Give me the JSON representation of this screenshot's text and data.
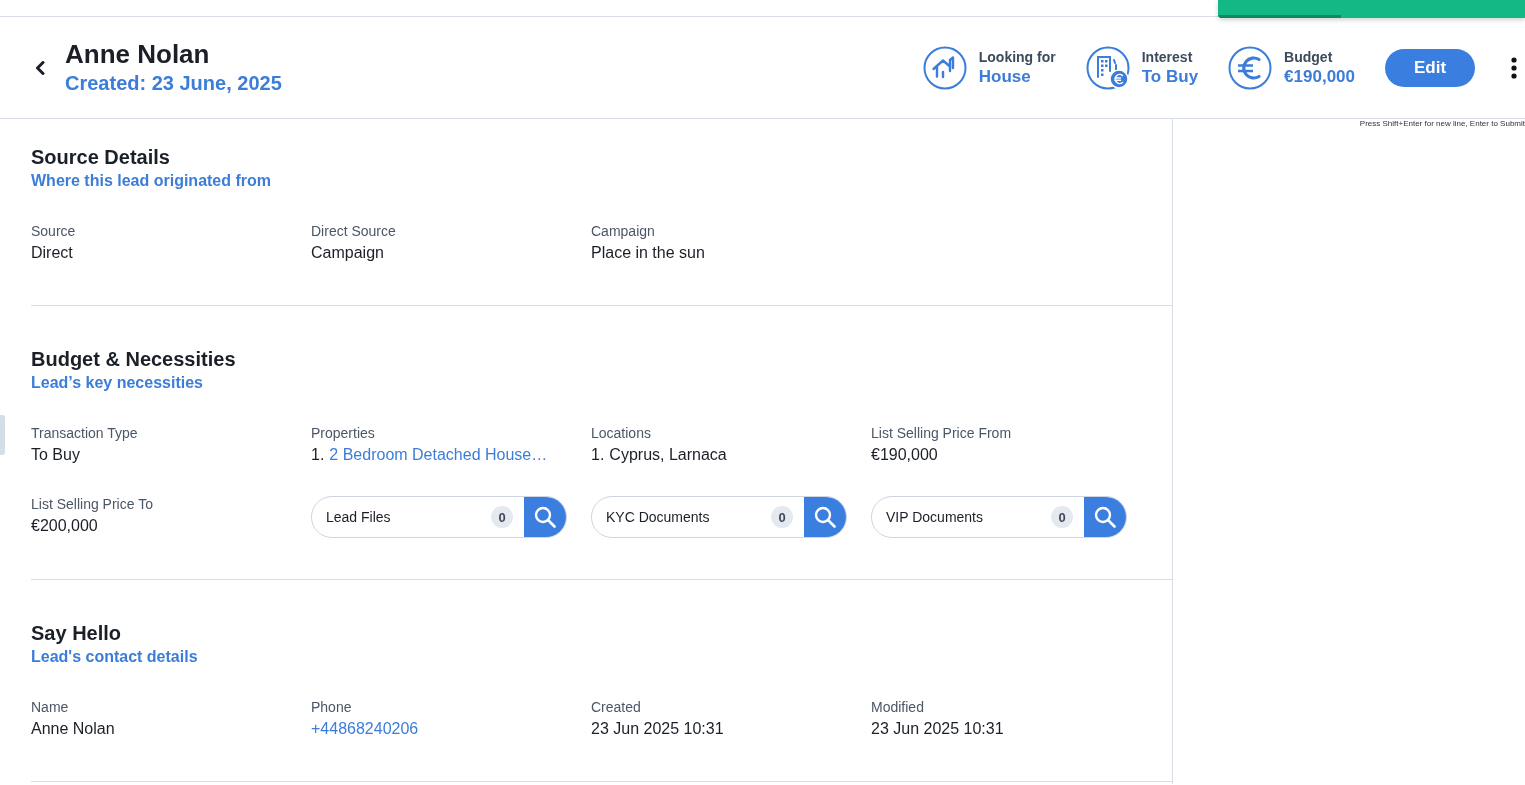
{
  "toast": {
    "level": 0.4
  },
  "header": {
    "title": "Anne Nolan",
    "subtitle": "Created: 23 June, 2025",
    "stats": [
      {
        "kind": "house",
        "label": "Looking for",
        "value": "House"
      },
      {
        "kind": "building",
        "label": "Interest",
        "value": "To Buy"
      },
      {
        "kind": "euro",
        "label": "Budget",
        "value": "€190,000"
      }
    ],
    "edit_label": "Edit"
  },
  "sections": [
    {
      "title": "Source Details",
      "subtitle": "Where this lead originated from",
      "fields": [
        {
          "kind": "text",
          "label": "Source",
          "value": "Direct"
        },
        {
          "kind": "text",
          "label": "Direct Source",
          "value": "Campaign"
        },
        {
          "kind": "text",
          "label": "Campaign",
          "value": "Place in the sun"
        }
      ]
    },
    {
      "title": "Budget & Necessities",
      "subtitle": "Lead’s key necessities",
      "fields": [
        {
          "kind": "text",
          "label": "Transaction Type",
          "value": "To Buy"
        },
        {
          "kind": "list",
          "label": "Properties",
          "items": [
            {
              "number": "1.",
              "text": "2 Bedroom Detached House…",
              "link": true
            }
          ]
        },
        {
          "kind": "list",
          "label": "Locations",
          "items": [
            {
              "number": "1.",
              "text": "Cyprus, Larnaca",
              "link": false
            }
          ]
        },
        {
          "kind": "text",
          "label": "List Selling Price From",
          "value": "€190,000"
        },
        {
          "kind": "text",
          "label": "List Selling Price To",
          "value": "€200,000"
        },
        {
          "kind": "files",
          "label": "Lead Files",
          "count": "0"
        },
        {
          "kind": "files",
          "label": "KYC Documents",
          "count": "0"
        },
        {
          "kind": "files",
          "label": "VIP Documents",
          "count": "0"
        }
      ]
    },
    {
      "title": "Say Hello",
      "subtitle": "Lead's contact details",
      "fields": [
        {
          "kind": "text",
          "label": "Name",
          "value": "Anne Nolan"
        },
        {
          "kind": "link",
          "label": "Phone",
          "value": "+44868240206"
        },
        {
          "kind": "text",
          "label": "Created",
          "value": "23 Jun 2025 10:31"
        },
        {
          "kind": "text",
          "label": "Modified",
          "value": "23 Jun 2025 10:31"
        }
      ]
    }
  ],
  "side_panel": {
    "hint": "Press Shift+Enter for new line, Enter to Submit"
  }
}
